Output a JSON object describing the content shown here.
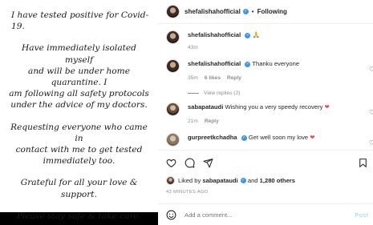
{
  "image_text": {
    "p1": "I have tested positive for Covid-19.",
    "p2": "Have immediately isolated myself\nand will be under home quarantine. I\nam following all safety protocols\nunder the advice of my doctors.",
    "p3": "Requesting everyone who came in\ncontact with me to get tested\nimmediately too.",
    "p4": "Grateful for all your love & support.",
    "p5": "Please stay safe & take care."
  },
  "header": {
    "username": "shefalishahofficial",
    "separator": "•",
    "follow_label": "Following"
  },
  "caption": {
    "username": "shefalishahofficial",
    "text": "🙏",
    "time": "43m"
  },
  "comments": [
    {
      "username": "shefalishahofficial",
      "text": "Thanku everyone",
      "time": "35m",
      "likes": "6 likes",
      "reply": "Reply"
    },
    {
      "username": "sabapataudi",
      "text": "Wishing you a very speedy recovery",
      "heart": "❤",
      "time": "21m",
      "reply": "Reply"
    },
    {
      "username": "gurpreetkchadha",
      "text": "Get well soon my love",
      "heart": "❤",
      "time": "",
      "reply": ""
    }
  ],
  "view_replies": "View replies (2)",
  "likes_line": {
    "prefix": "Liked by",
    "user": "sabapataudi",
    "middle": "and",
    "others": "1,280 others"
  },
  "timestamp": "43 MINUTES AGO",
  "add_comment": {
    "placeholder": "Add a comment...",
    "post_label": "Post"
  },
  "colors": {
    "verified": "#3897f0",
    "heart": "#ed4956",
    "post_disabled": "#b2dffc",
    "muted": "#8e8e8e"
  }
}
